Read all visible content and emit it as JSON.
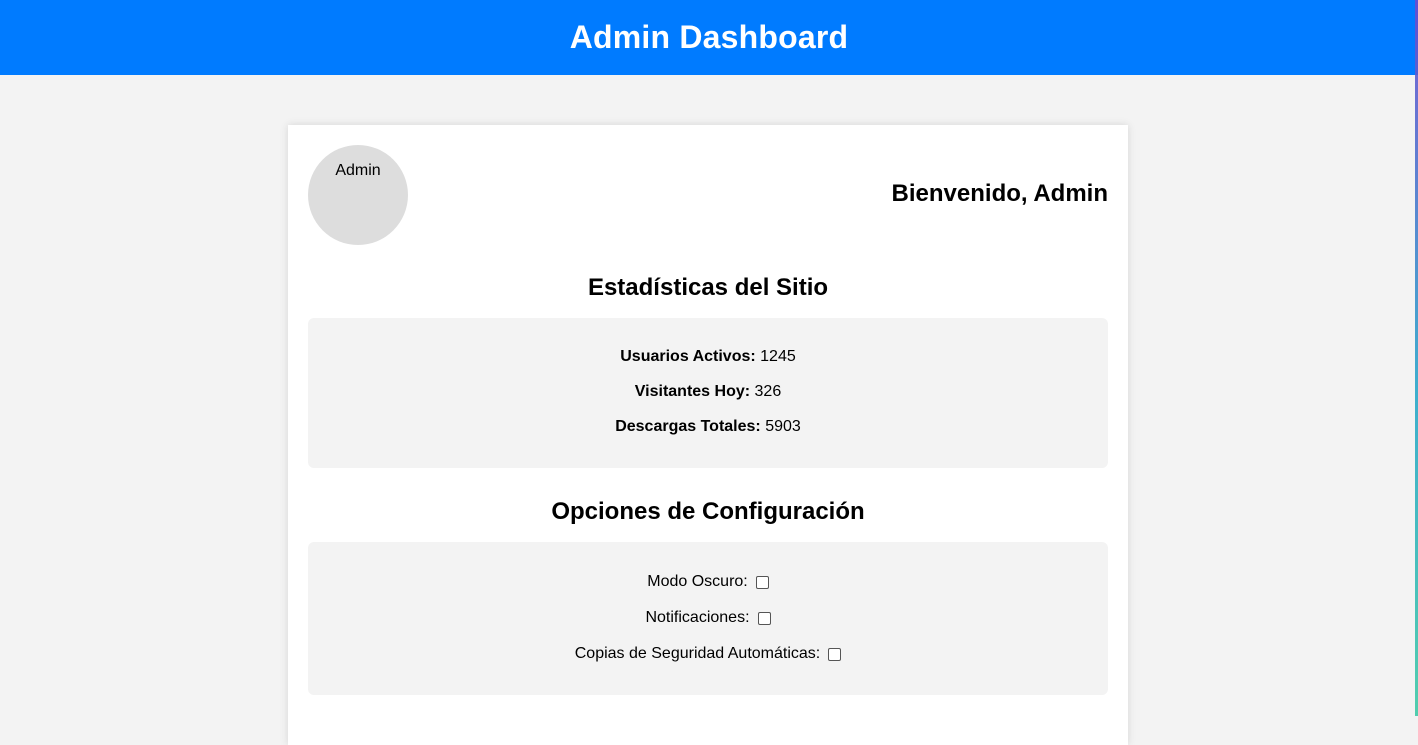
{
  "header": {
    "title": "Admin Dashboard"
  },
  "profile": {
    "label": "Admin"
  },
  "welcome": "Bienvenido, Admin",
  "stats": {
    "title": "Estadísticas del Sitio",
    "items": [
      {
        "label": "Usuarios Activos:",
        "value": "1245"
      },
      {
        "label": "Visitantes Hoy:",
        "value": "326"
      },
      {
        "label": "Descargas Totales:",
        "value": "5903"
      }
    ]
  },
  "config": {
    "title": "Opciones de Configuración",
    "options": [
      {
        "label": "Modo Oscuro:",
        "checked": false
      },
      {
        "label": "Notificaciones:",
        "checked": false
      },
      {
        "label": "Copias de Seguridad Automáticas:",
        "checked": false
      }
    ]
  },
  "colors": {
    "header_bg": "#007bff",
    "page_bg": "#f3f3f3",
    "panel_bg": "#f3f3f3",
    "avatar_bg": "#dddddd"
  }
}
